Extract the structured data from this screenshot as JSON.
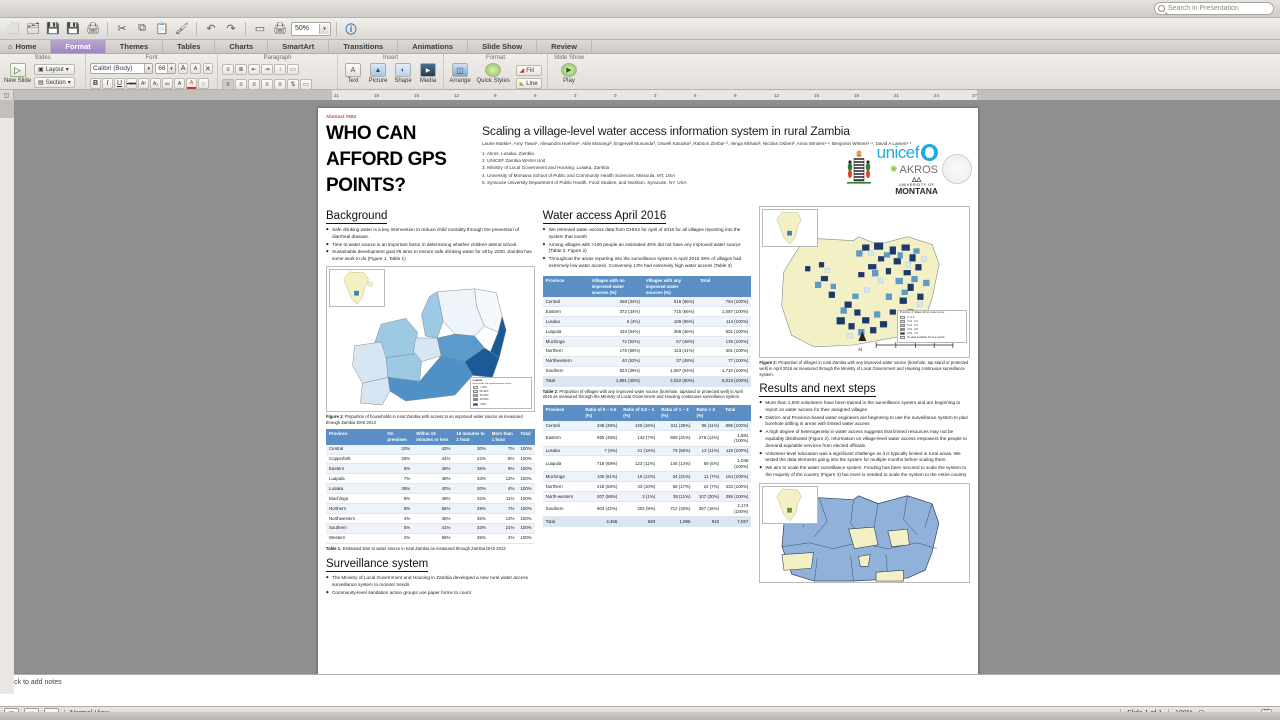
{
  "window": {
    "search_placeholder": "Search in Presentation",
    "zoom_toolbar": "50%"
  },
  "quick_toolbar": [
    {
      "name": "new",
      "glyph": "⬜"
    },
    {
      "name": "open",
      "glyph": "🗂"
    },
    {
      "name": "save-as",
      "glyph": "💾"
    },
    {
      "name": "save",
      "glyph": "💾"
    },
    {
      "name": "print",
      "glyph": "🖨"
    },
    {
      "name": "cut",
      "glyph": "✂"
    },
    {
      "name": "copy",
      "glyph": "⧉"
    },
    {
      "name": "paste",
      "glyph": "📋"
    },
    {
      "name": "format-painter",
      "glyph": "🖌"
    },
    {
      "name": "undo",
      "glyph": "↶"
    },
    {
      "name": "redo",
      "glyph": "↷"
    },
    {
      "name": "new-slide",
      "glyph": "▭"
    },
    {
      "name": "print-preview",
      "glyph": "🖨"
    },
    {
      "name": "help",
      "glyph": "?"
    }
  ],
  "ribbon": {
    "tabs": [
      {
        "label": "Home",
        "active": false,
        "icon": "home-icon"
      },
      {
        "label": "Format",
        "active": true
      },
      {
        "label": "Themes",
        "active": false
      },
      {
        "label": "Tables",
        "active": false
      },
      {
        "label": "Charts",
        "active": false
      },
      {
        "label": "SmartArt",
        "active": false
      },
      {
        "label": "Transitions",
        "active": false
      },
      {
        "label": "Animations",
        "active": false
      },
      {
        "label": "Slide Show",
        "active": false
      },
      {
        "label": "Review",
        "active": false
      }
    ],
    "groups": {
      "slides": {
        "title": "Slides",
        "new_slide": "New Slide",
        "layout": "Layout",
        "section": "Section"
      },
      "font": {
        "title": "Font",
        "family": "Calibri (Body)",
        "size": "66",
        "grow": "A",
        "shrink": "A",
        "clear": "⌫",
        "bold": "B",
        "italic": "I",
        "underline": "U",
        "strike": "ABC",
        "superscript": "A²",
        "subscript": "A₂",
        "spacing": "AV",
        "effects": "A",
        "color": "A",
        "highlight": "◇"
      },
      "paragraph": {
        "title": "Paragraph",
        "bullets": "≡",
        "numbering": "≡",
        "decrease_indent": "⇤",
        "increase_indent": "⇥",
        "line_spacing": "↕",
        "columns": "▥",
        "align_left": "≡",
        "align_center": "≡",
        "align_right": "≡",
        "justify": "≡",
        "distribute": "≡",
        "text_direction": "↕",
        "align_text": "▭"
      },
      "insert": {
        "title": "Insert",
        "items": [
          {
            "label": "Text",
            "icon": "text-box-icon",
            "glyph": "A"
          },
          {
            "label": "Picture",
            "icon": "picture-icon",
            "glyph": "🖼"
          },
          {
            "label": "Shape",
            "icon": "shape-icon",
            "glyph": "⬟"
          },
          {
            "label": "Media",
            "icon": "media-icon",
            "glyph": "🎬"
          }
        ]
      },
      "format": {
        "title": "Format",
        "items": [
          {
            "label": "Arrange",
            "icon": "arrange-icon",
            "glyph": "◫"
          },
          {
            "label": "Quick Styles",
            "icon": "quick-styles-icon",
            "glyph": "●"
          }
        ],
        "fill": "Fill",
        "line": "Line"
      },
      "slideshow": {
        "title": "Slide Show",
        "play": "Play"
      }
    }
  },
  "ruler": {
    "horizontal": [
      "21",
      "18",
      "15",
      "12",
      "9",
      "6",
      "3",
      "0",
      "3",
      "6",
      "9",
      "12",
      "15",
      "18",
      "21",
      "24",
      "27"
    ]
  },
  "poster": {
    "abstract_id": "Abstract #504",
    "big_title": "WHO CAN AFFORD GPS POINTS?",
    "title": "Scaling a village-level water access information system in rural Zambia",
    "authors": "Laurie Markle¹, Amy Tiwari¹, Alexandra Hoehne², Able Manangi³, Engervell Musonda³, Oswell Katooka³, Rabson Zimba¹·³, Ilenga Nkhata³, Nicolas Osbert², Anna Winters¹·⁴, Benjamin Winters¹·⁴, David A Larsen¹·⁵",
    "affiliations": [
      "1.  Akros, Lusaka, Zambia",
      "2.  UNICEF Zambia WASH Unit",
      "3. Ministry of Local Government and Housing, Lusaka, Zambia",
      "4. University of Montana School of Public and Community Health Sciences, Missoula, MT, USA",
      "5. Syracuse University Department of Public Health, Food Studies, and Nutrition, Syracuse, NY, USA"
    ],
    "logos": {
      "unicef": "unicef",
      "akros": "AKROS",
      "montana_top": "UNIVERSITY OF",
      "montana": "MONTANA"
    },
    "sections": {
      "background": {
        "heading": "Background",
        "bullets": [
          "Safe drinking water is a key intervention to reduce child mortality through the prevention of diarrheal disease.",
          "Time to water source is an important factor in determining whether children attend school.",
          "Sustainable development goal #6 aims to ensure safe drinking water for all by 2030. Zambia has some work to do (Figure 1, Table 1)"
        ],
        "figure1_caption_label": "Figure 1:",
        "figure1_caption": " Proportion of households in rural Zambia with access to an improved water source as measured through Zambia DHS 2013",
        "table1_caption_label": "Table 1:",
        "table1_caption": " Estimated time to water source in rural Zambia as measured through Zambia DHS 2013"
      },
      "surveillance": {
        "heading": "Surveillance system",
        "bullets": [
          "The Ministry of Local Government and Housing in Zambia developed a new rural water access surveillance system to monitor trends",
          "Community-level sanitation action groups use paper forms to count"
        ]
      },
      "water_access": {
        "heading": "Water access April 2016",
        "bullets": [
          "We retrieved water access data from DHIS2 for April of 2016 for all villages reporting into the system that month",
          "Among villages with >100 people an estimated 40% did not have any improved water source (Table 2, Figure 2)",
          "Throughout the areas reporting into the surveillance system in April 2016 49% of villages had extremely low water access. Conversely 13% had extremely high water access (Table 3)"
        ],
        "table2_caption_label": "Table 2:",
        "table2_caption": " Proportion of villages with any improved water source (borehole, tapstand or protected well) in April 2016 as measured through the Ministry of Local Government and Housing continuous surveillance system"
      },
      "results": {
        "heading": "Results and next steps",
        "bullets": [
          "More than 1,500 volunteers have been trained in the surveillance system and are beginning to report on water access for their assigned villages",
          "District- and Province-based water engineers are beginning to use the surveillance system to plan borehole drilling in areas with limited water access",
          "A high degree of heterogeneity in water access suggests that limited resources may not be equitably distributed (Figure 2). Information on village-level water access empowers the people to demand equitable services from elected officials",
          "Volunteer-level education was a significant challenge as it is typically limited in rural areas. We tested the data elements going into the system for multiple months before scaling them.",
          "We aim to scale the water surveillance system. Funding has been secured to scale the system to the majority of the country (Figure 3) but more is needed to scale the system to the entire country"
        ],
        "figure2_caption_label": "Figure 2:",
        "figure2_caption": " Proportion of villages in rural Zambia with any improved water source (borehole, tap stand or protected well) in April 2016 as measured through the Ministry of Local Government and Housing continuous surveillance system."
      }
    },
    "table1": {
      "headers": [
        "Province",
        "On premises",
        "Within 15 minutes or less",
        "16 minutes to 1 hour",
        "More than 1 hour",
        "Total"
      ],
      "rows": [
        [
          "Central",
          "20%",
          "43%",
          "30%",
          "7%",
          "100%"
        ],
        [
          "Copperbelt",
          "26%",
          "44%",
          "22%",
          "8%",
          "100%"
        ],
        [
          "Eastern",
          "6%",
          "49%",
          "36%",
          "9%",
          "100%"
        ],
        [
          "Luapula",
          "7%",
          "48%",
          "33%",
          "12%",
          "100%"
        ],
        [
          "Lusaka",
          "35%",
          "40%",
          "20%",
          "4%",
          "100%"
        ],
        [
          "Muchinga",
          "9%",
          "48%",
          "32%",
          "11%",
          "100%"
        ],
        [
          "Northern",
          "8%",
          "56%",
          "29%",
          "7%",
          "100%"
        ],
        [
          "Northwestern",
          "4%",
          "46%",
          "36%",
          "13%",
          "100%"
        ],
        [
          "Southern",
          "5%",
          "41%",
          "33%",
          "21%",
          "100%"
        ],
        [
          "Western",
          "2%",
          "59%",
          "35%",
          "4%",
          "100%"
        ]
      ]
    },
    "table2": {
      "headers": [
        "Province",
        "Villages with no improved water sources (%)",
        "Villages with any improved water sources (%)",
        "Total"
      ],
      "rows": [
        [
          "Central",
          "268 (34%)",
          "516 (66%)",
          "784 (100%)"
        ],
        [
          "Eastern",
          "372 (34%)",
          "715 (66%)",
          "1,087 (100%)"
        ],
        [
          "Lusaka",
          "5 (4%)",
          "109 (96%)",
          "114 (100%)"
        ],
        [
          "Luapula",
          "433 (54%)",
          "368 (46%)",
          "801 (100%)"
        ],
        [
          "Muchinga",
          "72 (52%)",
          "67 (48%)",
          "139 (100%)"
        ],
        [
          "Northern",
          "178 (59%)",
          "123 (41%)",
          "301 (100%)"
        ],
        [
          "Northwestern",
          "40 (52%)",
          "37 (48%)",
          "77 (100%)"
        ],
        [
          "Southern",
          "623 (36%)",
          "1,087 (64%)",
          "1,710 (100%)"
        ],
        [
          "Total",
          "1,991 (40%)",
          "3,022 (60%)",
          "5,013 (100%)"
        ]
      ]
    },
    "table3": {
      "headers": [
        "Province",
        "Ratio of 0 – 0.5 (%)",
        "Ratio of 0.5 – 1 (%)",
        "Ratio of 1 – 3 (%)",
        "Ratio > 3 (%)",
        "Total"
      ],
      "rows": [
        [
          "Central",
          "348 (39%)",
          "140 (16%)",
          "311 (35%)",
          "96 (11%)",
          "895 (100%)"
        ],
        [
          "Eastern",
          "955 (48%)",
          "142 (7%)",
          "609 (31%)",
          "275 (14%)",
          "1,981 (100%)"
        ],
        [
          "Lusaka",
          "7 (6%)",
          "21 (18%)",
          "78 (66%)",
          "13 (11%)",
          "119 (100%)"
        ],
        [
          "Luapula",
          "718 (69%)",
          "123 (12%)",
          "146 (14%)",
          "59 (6%)",
          "1,046 (100%)"
        ],
        [
          "Muchinga",
          "100 (61%)",
          "19 (12%)",
          "34 (21%)",
          "11 (7%)",
          "164 (100%)"
        ],
        [
          "Northern",
          "218 (65%)",
          "33 (10%)",
          "58 (17%)",
          "24 (7%)",
          "333 (100%)"
        ],
        [
          "North-western",
          "207 (58%)",
          "3 (1%)",
          "38 (11%)",
          "107 (30%)",
          "355 (100%)"
        ],
        [
          "Southern",
          "903 (42%)",
          "202 (9%)",
          "712 (33%)",
          "357 (16%)",
          "2,174 (100%)"
        ],
        [
          "Total",
          "3,456",
          "683",
          "1,986",
          "942",
          "7,067"
        ]
      ]
    },
    "figure1": {
      "legend_title": "Legend",
      "legend_subtitle": "Households with improved water source",
      "legend_items": [
        "< 20%",
        "20-34%",
        "35-44%",
        "45-60%",
        ">60%"
      ]
    },
    "figure2": {
      "legend_title": "Proportion of villages with any water source",
      "legend_items": [
        "0 - 0.2",
        "0.21 - 0.4",
        "0.41 - 0.6",
        "0.61 - 0.8",
        "0.81 - 1.0",
        "No data available for time period"
      ],
      "scale": [
        "0",
        "100",
        "200",
        "400",
        "600 km"
      ],
      "north": "N"
    }
  },
  "notes": {
    "placeholder": "Click to add notes"
  },
  "status": {
    "view_normal": "▤",
    "view_sorter": "∷",
    "view_show": "▭",
    "view_label": "Normal View",
    "slide_count": "Slide 1 of 1",
    "zoom": "100%",
    "fit": "⤧"
  }
}
